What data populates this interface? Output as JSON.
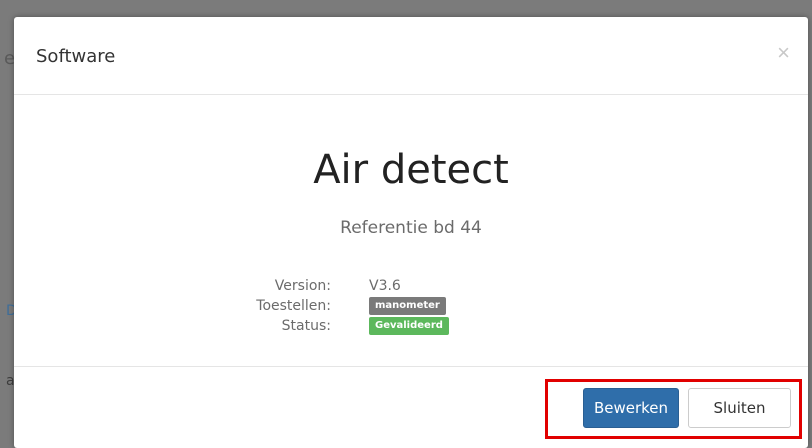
{
  "background": {
    "fragment_1": "e",
    "fragment_2": "D",
    "fragment_3": "al"
  },
  "modal": {
    "title": "Software",
    "close_symbol": "×"
  },
  "product": {
    "name": "Air detect",
    "reference": "Referentie bd 44"
  },
  "details": {
    "version_label": "Version:",
    "version_value": "V3.6",
    "devices_label": "Toestellen:",
    "devices_badge": "manometer",
    "status_label": "Status:",
    "status_badge": "Gevalideerd"
  },
  "footer": {
    "edit_label": "Bewerken",
    "close_label": "Sluiten"
  },
  "colors": {
    "primary": "#2f6eaa",
    "badge_grey": "#7a7a7a",
    "badge_green": "#5cb85c",
    "highlight": "#e10000"
  }
}
